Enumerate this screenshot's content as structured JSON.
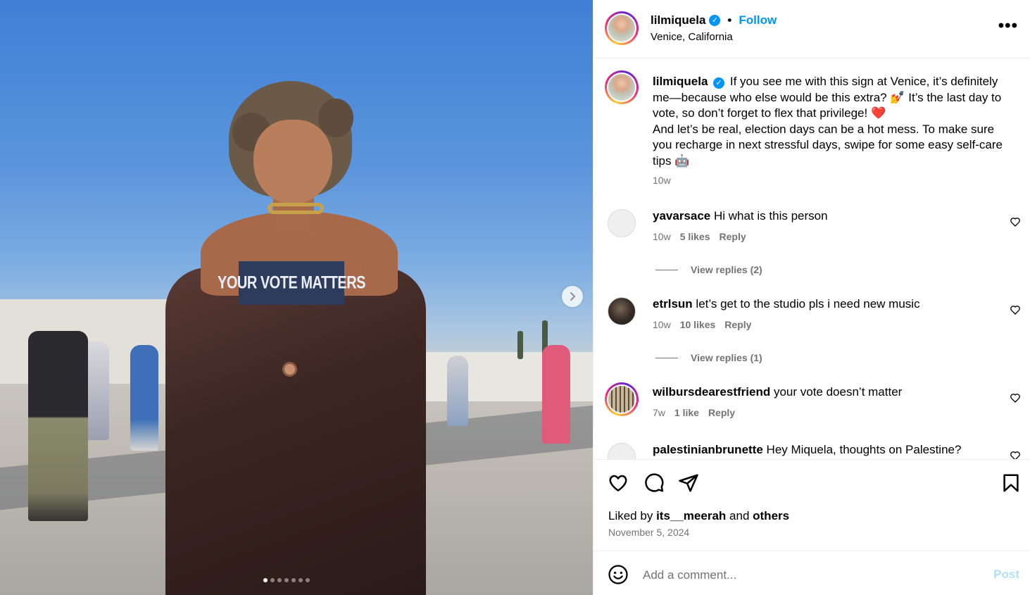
{
  "photo": {
    "sign_text": "YOUR VOTE MATTERS",
    "carousel_total": 7,
    "carousel_active": 1
  },
  "header": {
    "username": "lilmiquela",
    "separator": "•",
    "follow_label": "Follow",
    "location": "Venice, California",
    "more_label": "•••"
  },
  "caption": {
    "username": "lilmiquela",
    "line1": "If you see me with this sign at Venice, it’s definitely me—because who else would be this extra? 💅 It’s the last day to vote, so don’t forget to flex that privilege! ❤️",
    "line2": "And let’s be real, election days can be a hot mess. To make sure you recharge in next stressful days, swipe for some easy self-care tips 🤖",
    "time": "10w"
  },
  "comments": [
    {
      "username": "yavarsace",
      "text": "Hi what is this person",
      "time": "10w",
      "likes": "5 likes",
      "reply": "Reply",
      "view_replies": "View replies (2)"
    },
    {
      "username": "etrlsun",
      "text": "let’s get to the studio pls i need new music",
      "time": "10w",
      "likes": "10 likes",
      "reply": "Reply",
      "view_replies": "View replies (1)"
    },
    {
      "username": "wilbursdearestfriend",
      "text": "your vote doesn’t matter",
      "time": "7w",
      "likes": "1 like",
      "reply": "Reply"
    },
    {
      "username": "palestinianbrunette",
      "text": "Hey Miquela, thoughts on Palestine?"
    }
  ],
  "footer": {
    "liked_prefix": "Liked by",
    "liked_user": "its__meerah",
    "liked_and": "and",
    "liked_others": "others",
    "date": "November 5, 2024",
    "comment_placeholder": "Add a comment...",
    "post_label": "Post"
  },
  "icons": [
    "heart-icon",
    "comment-icon",
    "share-icon",
    "bookmark-icon",
    "emoji-icon",
    "chevron-right-icon",
    "verified-icon",
    "more-icon"
  ],
  "colors": {
    "accent": "#0095f6",
    "muted": "#737373",
    "post_disabled": "#b2dffc",
    "sign": "#2d3c5c"
  }
}
